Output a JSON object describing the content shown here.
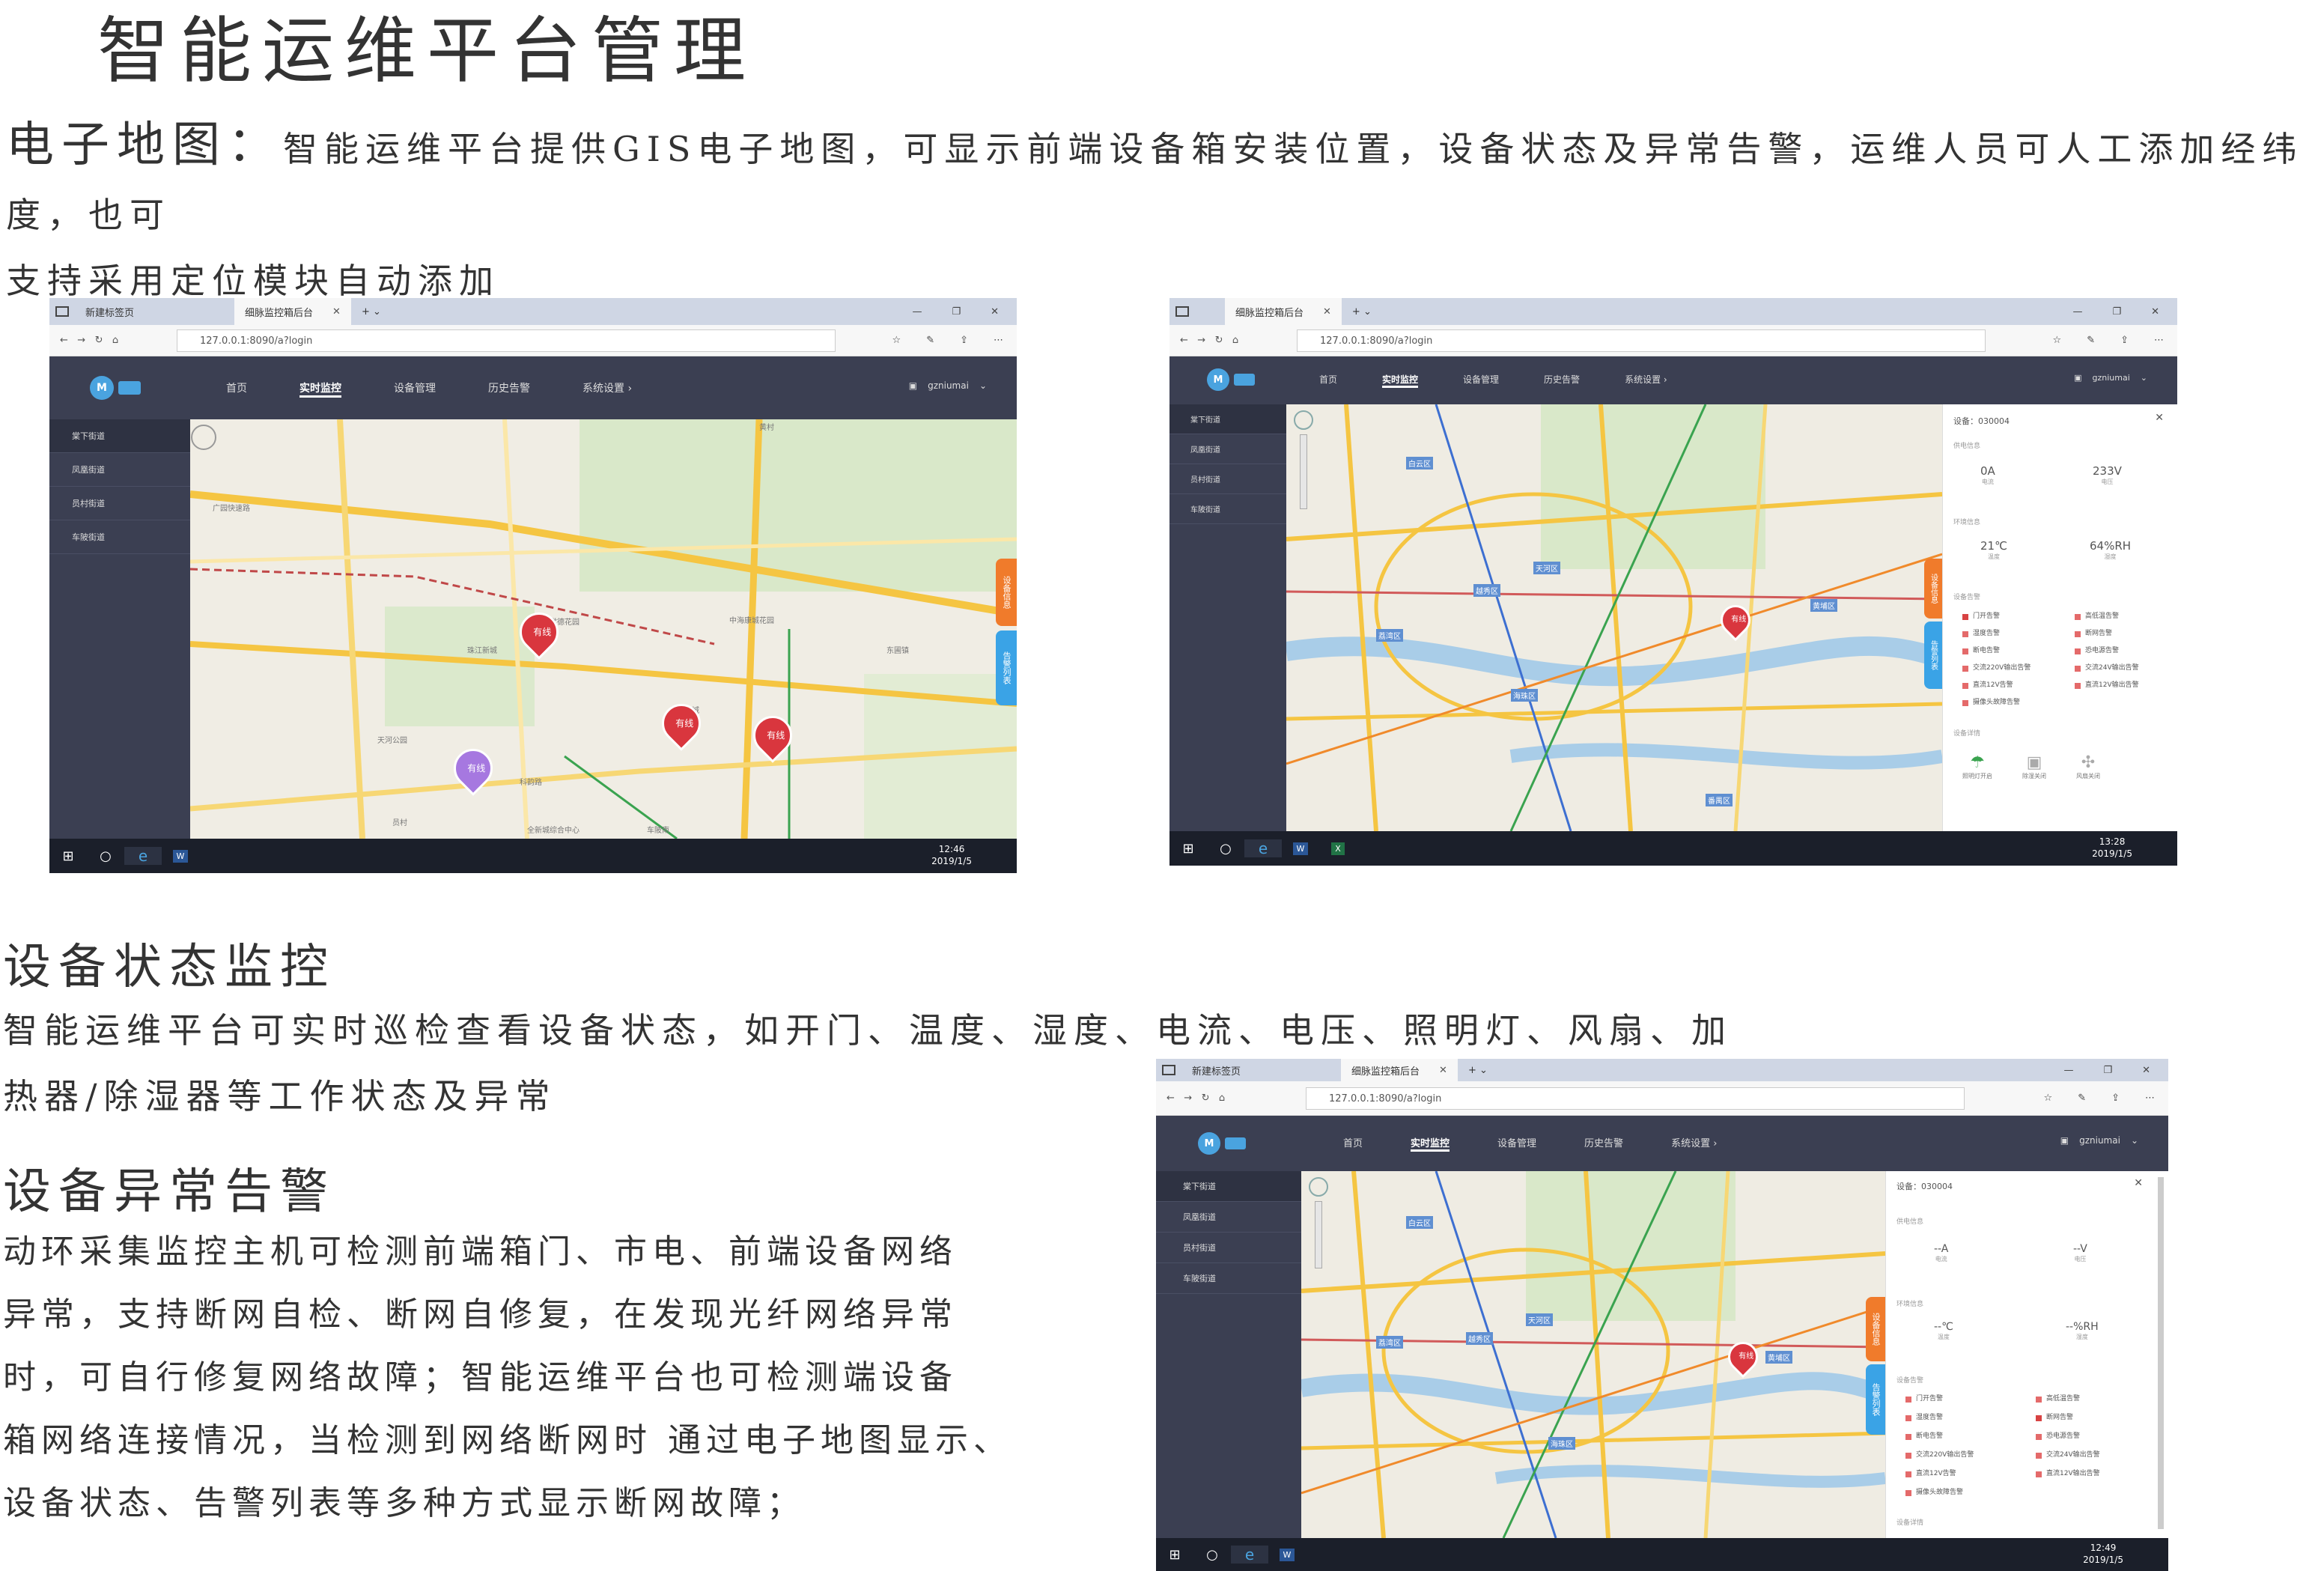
{
  "page": {
    "title": "智能运维平台管理",
    "gis_label": "电子地图：",
    "gis_text_1": "智能运维平台提供GIS电子地图，可显示前端设备箱安装位置，设备状态及异常告警，运维人员可人工添加经纬度，也可",
    "gis_text_2": "支持采用定位模块自动添加",
    "status_heading": "设备状态监控",
    "status_text_1": "智能运维平台可实时巡检查看设备状态，如开门、温度、湿度、电流、电压、照明灯、风扇、加",
    "status_text_2": "热器/除湿器等工作状态及异常",
    "alarm_heading": "设备异常告警",
    "alarm_lines": [
      "动环采集监控主机可检测前端箱门、市电、前端设备网络",
      "异常，支持断网自检、断网自修复，在发现光纤网络异常",
      "时，可自行修复网络故障；智能运维平台也可检测端设备",
      "箱网络连接情况，当检测到网络断网时 通过电子地图显示、",
      "设备状态、告警列表等多种方式显示断网故障；"
    ]
  },
  "browser": {
    "tab_new": "新建标签页",
    "tab_app": "细脉监控箱后台",
    "url": "127.0.0.1:8090/a?login",
    "menu": [
      "首页",
      "实时监控",
      "设备管理",
      "历史告警",
      "系统设置 ›"
    ],
    "user": "gzniumai",
    "streets": [
      "棠下街道",
      "凤凰街道",
      "员村街道",
      "车陂街道"
    ],
    "float_orange": "设备信息",
    "float_blue": "告警列表"
  },
  "shot1": {
    "clock_time": "12:46",
    "clock_date": "2019/1/5",
    "pin_label": "有线",
    "map_labels": [
      "广园快速路",
      "黄村",
      "车陂南",
      "科韵路",
      "员村",
      "天河公园",
      "中海康城花园",
      "全新城综合中心",
      "东圃镇",
      "华景新城",
      "棠德花园",
      "珠江新城"
    ]
  },
  "shot2": {
    "clock_time": "13:28",
    "clock_date": "2019/1/5",
    "device": "设备：030004",
    "power_title": "供电信息",
    "current": "0A",
    "current_label": "电流",
    "voltage": "233V",
    "voltage_label": "电压",
    "env_title": "环境信息",
    "temp": "21℃",
    "temp_label": "温度",
    "humidity": "64%RH",
    "humidity_label": "湿度",
    "alarm_title": "设备告警",
    "alarms_left": [
      "门开告警",
      "湿度告警",
      "断电告警",
      "交流220V输出告警",
      "直流12V告警",
      "摄像头故障告警"
    ],
    "alarms_right": [
      "高低温告警",
      "断网告警",
      "恐电源告警",
      "交流24V输出告警",
      "直流12V输出告警"
    ],
    "detail_title": "设备详情",
    "details": [
      "照明灯开启",
      "除湿关闭",
      "风扇关闭"
    ],
    "map_labels": [
      "白云区",
      "天河区",
      "越秀区",
      "荔湾区",
      "海珠区",
      "黄埔区",
      "番禺区"
    ]
  },
  "shot3": {
    "clock_time": "12:49",
    "clock_date": "2019/1/5",
    "device": "设备：030004",
    "power_title": "供电信息",
    "current": "--A",
    "current_label": "电流",
    "voltage": "--V",
    "voltage_label": "电压",
    "env_title": "环境信息",
    "temp": "--℃",
    "temp_label": "温度",
    "humidity": "--%RH",
    "humidity_label": "湿度",
    "alarm_title": "设备告警",
    "alarms_left": [
      "门开告警",
      "湿度告警",
      "断电告警",
      "交流220V输出告警",
      "直流12V告警",
      "摄像头故障告警"
    ],
    "alarms_right": [
      "高低温告警",
      "断网告警",
      "恐电源告警",
      "交流24V输出告警",
      "直流12V输出告警"
    ],
    "detail_title": "设备详情",
    "map_labels": [
      "白云区",
      "天河区",
      "越秀区",
      "荔湾区",
      "海珠区",
      "黄埔区"
    ]
  }
}
